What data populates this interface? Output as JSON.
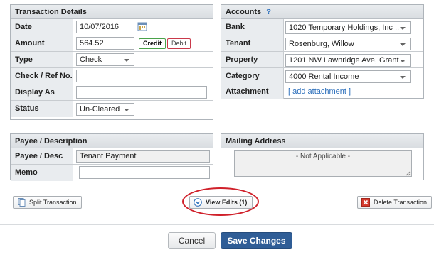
{
  "transaction": {
    "header": "Transaction Details",
    "date_label": "Date",
    "date_value": "10/07/2016",
    "amount_label": "Amount",
    "amount_value": "564.52",
    "credit_label": "Credit",
    "debit_label": "Debit",
    "type_label": "Type",
    "type_value": "Check",
    "checkref_label": "Check / Ref No.",
    "checkref_value": "",
    "displayas_label": "Display As",
    "displayas_value": "",
    "status_label": "Status",
    "status_value": "Un-Cleared"
  },
  "accounts": {
    "header": "Accounts",
    "help": "?",
    "bank_label": "Bank",
    "bank_value": "1020 Temporary Holdings, Inc ..",
    "tenant_label": "Tenant",
    "tenant_value": "Rosenburg, Willow",
    "property_label": "Property",
    "property_value": "1201 NW Lawnridge Ave, Grant ..",
    "category_label": "Category",
    "category_value": "4000 Rental Income",
    "attachment_label": "Attachment",
    "attachment_link": "[ add attachment ]"
  },
  "payee": {
    "header": "Payee / Description",
    "payee_label": "Payee / Desc",
    "payee_value": "Tenant Payment",
    "memo_label": "Memo",
    "memo_value": ""
  },
  "mailing": {
    "header": "Mailing Address",
    "value": "- Not Applicable -"
  },
  "actions": {
    "split_label": "Split Transaction",
    "view_edits_label": "View Edits (1)",
    "delete_label": "Delete Transaction",
    "cancel_label": "Cancel",
    "save_label": "Save Changes"
  },
  "colors": {
    "accent": "#2f5d96",
    "highlight_oval": "#d0202a",
    "credit_border": "#4aa24a",
    "debit_border": "#c9394a"
  }
}
